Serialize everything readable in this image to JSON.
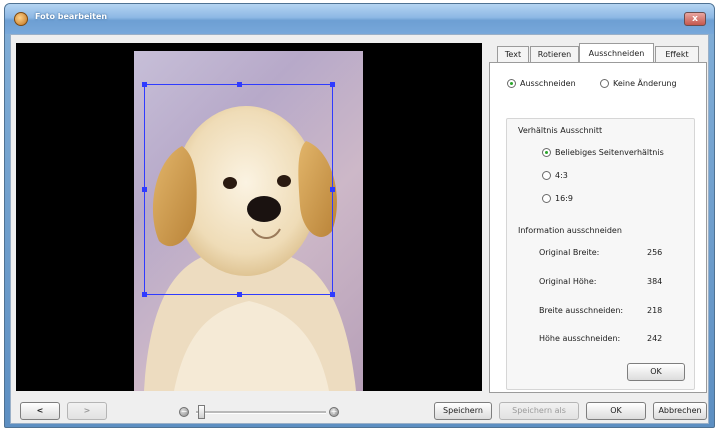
{
  "window": {
    "title": "Foto bearbeiten",
    "close_label": "x"
  },
  "tabs": [
    {
      "label": "Text"
    },
    {
      "label": "Rotieren"
    },
    {
      "label": "Ausschneiden"
    },
    {
      "label": "Effekt"
    }
  ],
  "crop": {
    "option_crop": "Ausschneiden",
    "option_none": "Keine Änderung",
    "ratio_group_title": "Verhältnis Ausschnitt",
    "ratios": [
      {
        "label": "Beliebiges Seitenverhältnis",
        "selected": true
      },
      {
        "label": "4:3",
        "selected": false
      },
      {
        "label": "16:9",
        "selected": false
      }
    ],
    "info_title": "Information ausschneiden",
    "info_rows": [
      {
        "label": "Original Breite:",
        "value": "256"
      },
      {
        "label": "Original Höhe:",
        "value": "384"
      },
      {
        "label": "Breite ausschneiden:",
        "value": "218"
      },
      {
        "label": "Höhe ausschneiden:",
        "value": "242"
      }
    ],
    "ok_label": "OK"
  },
  "bottom": {
    "prev_label": "<",
    "next_label": ">",
    "save_label": "Speichern",
    "save_as_label": "Speichern als",
    "ok_label": "OK",
    "cancel_label": "Abbrechen",
    "zoom_out_label": "−",
    "zoom_in_label": "+"
  },
  "colors": {
    "crop_frame": "#2f3bff",
    "selected_radio": "#2aa52a"
  }
}
